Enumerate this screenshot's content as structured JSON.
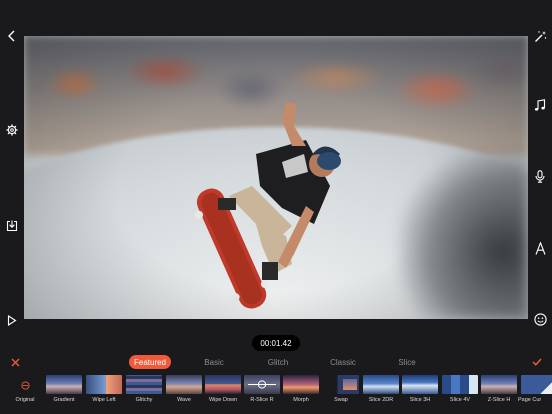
{
  "player": {
    "timestamp": "00:01.42"
  },
  "icons": {
    "back": "chevron-left-icon",
    "magic": "magic-wand-icon",
    "settings": "gear-icon",
    "music": "music-note-icon",
    "voice": "microphone-icon",
    "export": "download-icon",
    "text": "text-icon",
    "play": "play-icon",
    "sticker": "smiley-icon",
    "cancel": "close-icon",
    "confirm": "checkmark-icon"
  },
  "colors": {
    "accent": "#f05a3a",
    "background": "#1a1a1c",
    "tab_inactive": "#8c8c8e"
  },
  "tabs": [
    {
      "label": "Featured",
      "active": true
    },
    {
      "label": "Basic",
      "active": false
    },
    {
      "label": "Glitch",
      "active": false
    },
    {
      "label": "Classic",
      "active": false
    },
    {
      "label": "Slice",
      "active": false
    }
  ],
  "transitions": [
    {
      "label": "Original",
      "selected": true
    },
    {
      "label": "Gradient"
    },
    {
      "label": "Wipe Left"
    },
    {
      "label": "Glitchy"
    },
    {
      "label": "Wave"
    },
    {
      "label": "Wipe Down"
    },
    {
      "label": "R-Slice R"
    },
    {
      "label": "Morph"
    },
    {
      "label": "Swap"
    },
    {
      "label": "Slice 2DR"
    },
    {
      "label": "Slice 3H"
    },
    {
      "label": "Slice 4V"
    },
    {
      "label": "Z-Slice H"
    },
    {
      "label": "Page Cur"
    }
  ]
}
